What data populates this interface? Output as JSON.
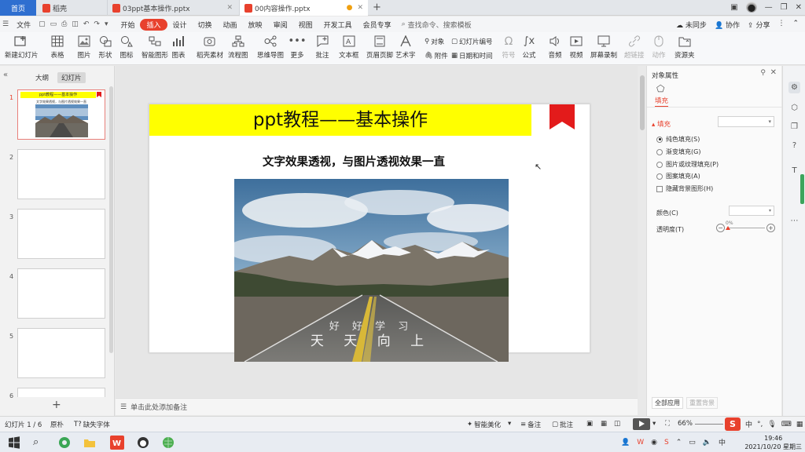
{
  "tabs": {
    "home": "首页",
    "t1": "稻壳",
    "t2": "03ppt基本操作.pptx",
    "t3": "00内容操作.pptx"
  },
  "menu": {
    "file": "文件",
    "items": [
      "开始",
      "插入",
      "设计",
      "切换",
      "动画",
      "放映",
      "审阅",
      "视图",
      "开发工具",
      "会员专享"
    ],
    "active": "插入",
    "search": "查找命令、搜索模板",
    "unsync": "未同步",
    "collab": "协作",
    "share": "分享"
  },
  "ribbon": {
    "new_slide": "新建幻灯片",
    "table": "表格",
    "picture": "图片",
    "shape": "形状",
    "icon": "图标",
    "smartart": "智能图形",
    "chart": "图表",
    "docer": "稻壳素材",
    "flowchart": "流程图",
    "mindmap": "思维导图",
    "more": "更多",
    "comment": "批注",
    "textbox": "文本框",
    "header_footer": "页眉页脚",
    "wordart": "艺术字",
    "object": "对象",
    "attachment": "附件",
    "slide_number": "幻灯片编号",
    "date_time": "日期和时间",
    "symbol": "符号",
    "formula": "公式",
    "audio": "音频",
    "video": "视频",
    "screen_record": "屏幕录制",
    "hyperlink": "超链接",
    "action": "动作",
    "resources": "资源夹"
  },
  "left_panel": {
    "tab_outline": "大纲",
    "tab_slides": "幻灯片",
    "slide_numbers": [
      "1",
      "2",
      "3",
      "4",
      "5",
      "6"
    ],
    "add_slide": "+"
  },
  "slide": {
    "title": "ppt教程——基本操作",
    "subtitle": "文字效果透视，与图片透视效果一直",
    "photo_text_top": "好 好 学 习",
    "photo_text_bottom": "天 天 向 上"
  },
  "notes": "单击此处添加备注",
  "right_pane": {
    "title": "对象属性",
    "tab_fill": "填充",
    "section_fill": "填充",
    "options": [
      "纯色填充(S)",
      "渐变填充(G)",
      "图片或纹理填充(P)",
      "图案填充(A)"
    ],
    "selected_option": 0,
    "hide_bg": "隐藏背景图形(H)",
    "color_label": "颜色(C)",
    "transparency_label": "透明度(T)",
    "transparency_value": "0%",
    "apply_all": "全部应用",
    "reset_bg": "重置背景"
  },
  "status": {
    "slide_count": "幻灯片 1 / 6",
    "theme": "原朴",
    "missing_font": "缺失字体",
    "smart_beautify": "智能美化",
    "notes": "备注",
    "comments": "批注",
    "zoom": "66%",
    "ime": "中"
  },
  "taskbar": {
    "time": "19:46",
    "date": "2021/10/20 星期三"
  },
  "colors": {
    "accent": "#e8412d",
    "title_bg": "#ffff00",
    "bookmark": "#e31b1b"
  }
}
